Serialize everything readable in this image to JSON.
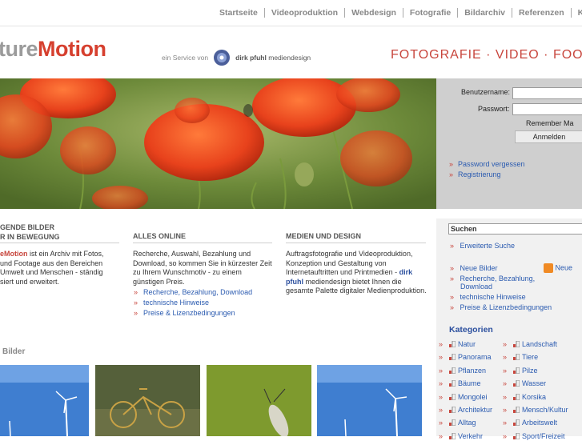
{
  "nav": {
    "items": [
      "Startseite",
      "Videoproduktion",
      "Webdesign",
      "Fotografie",
      "Bildarchiv",
      "Referenzen",
      "Ko"
    ]
  },
  "header": {
    "logo_part1": "ture",
    "logo_part2": "Motion",
    "service_prefix": "ein Service von",
    "service_brand": "dirk pfuhl",
    "service_brand_suffix": "mediendesign",
    "tagline": "FOTOGRAFIE · VIDEO · FOOT"
  },
  "login": {
    "username_label": "Benutzername:",
    "password_label": "Passwort:",
    "remember_label": "Remember Ma",
    "login_button": "Anmelden",
    "forgot_password": "Password vergessen",
    "register": "Registrierung"
  },
  "columns": {
    "col1": {
      "head_line1": "GENDE BILDER",
      "head_line2": "R IN BEWEGUNG",
      "brand": "eMotion",
      "text_after_brand": " ist ein Archiv mit Fotos,",
      "line2": " und Footage aus den Bereichen",
      "line3": " Umwelt und Menschen - ständig",
      "line4": "siert und erweitert."
    },
    "col2": {
      "head": "ALLES ONLINE",
      "text": "Recherche, Auswahl, Bezahlung und Download, so kommen Sie in kürzester Zeit zu Ihrem Wunschmotiv - zu einem günstigen Preis.",
      "links": [
        "Recherche, Bezahlung, Download",
        "technische Hinweise",
        "Preise & Lizenzbedingungen"
      ]
    },
    "col3": {
      "head": "MEDIEN UND DESIGN",
      "text_before": "Auftragsfotografie und Videoproduktion, Konzeption und Gestaltung von Internetauftritten und Printmedien -",
      "brand": "dirk pfuhl",
      "text_after": " mediendesign bietet Ihnen die gesamte Palette digitaler Medienproduktion."
    }
  },
  "bilder_title": "Bilder",
  "sidebar": {
    "search_label": "Suchen",
    "advanced_search": "Erweiterte Suche",
    "new_images": "Neue Bilder",
    "rss_label": "Neue",
    "links": [
      "Recherche, Bezahlung,",
      "Download",
      "technische Hinweise",
      "Preise & Lizenzbedingungen"
    ],
    "categories_title": "Kategorien",
    "categories_left": [
      "Natur",
      "Panorama",
      "Pflanzen",
      "Bäume",
      "Mongolei",
      "Architektur",
      "Alltag",
      "Verkehr"
    ],
    "categories_right": [
      "Landschaft",
      "Tiere",
      "Pilze",
      "Wasser",
      "Korsika",
      "Mensch/Kultur",
      "Arbeitswelt",
      "Sport/Freizeit"
    ]
  },
  "colors": {
    "accent": "#c8463d",
    "link": "#2b5bb0",
    "nav_text": "#888888"
  }
}
